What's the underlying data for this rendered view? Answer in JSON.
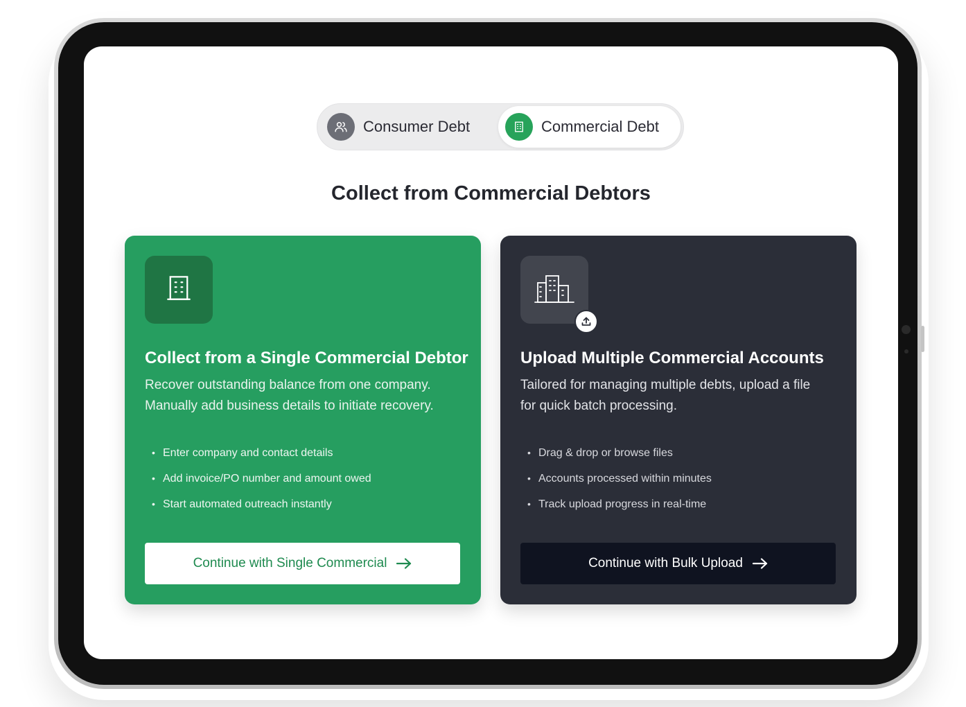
{
  "toggle": {
    "consumer_label": "Consumer Debt",
    "commercial_label": "Commercial Debt",
    "selected": "Commercial Debt"
  },
  "headline": "Collect from Commercial Debtors",
  "cards": {
    "single": {
      "title": "Collect from a Single Commercial Debtor",
      "desc_line1": "Recover outstanding balance from one company.",
      "desc_line2": "Manually add business details to initiate recovery.",
      "bullets": [
        "Enter company and contact details",
        "Add invoice/PO number and amount owed",
        "Start automated outreach instantly"
      ],
      "cta": "Continue with Single Commercial"
    },
    "bulk": {
      "title": "Upload Multiple Commercial Accounts",
      "desc_line1": "Tailored for managing multiple debts, upload a file",
      "desc_line2": "for quick batch processing.",
      "bullets": [
        "Drag & drop or browse files",
        "Accounts processed within minutes",
        "Track upload progress in real-time"
      ],
      "cta": "Continue with Bulk Upload"
    }
  },
  "bullet_glyph": "•",
  "colors": {
    "green_card": "#269e60",
    "dark_card": "#2b2e38",
    "accent_green": "#27a35a",
    "cta_dark": "#0f1320"
  },
  "icons": {
    "consumer": "users-icon",
    "commercial": "building-icon",
    "single_card": "building-icon",
    "bulk_card": "buildings-icon",
    "upload": "upload-icon",
    "arrow": "arrow-right-icon"
  }
}
